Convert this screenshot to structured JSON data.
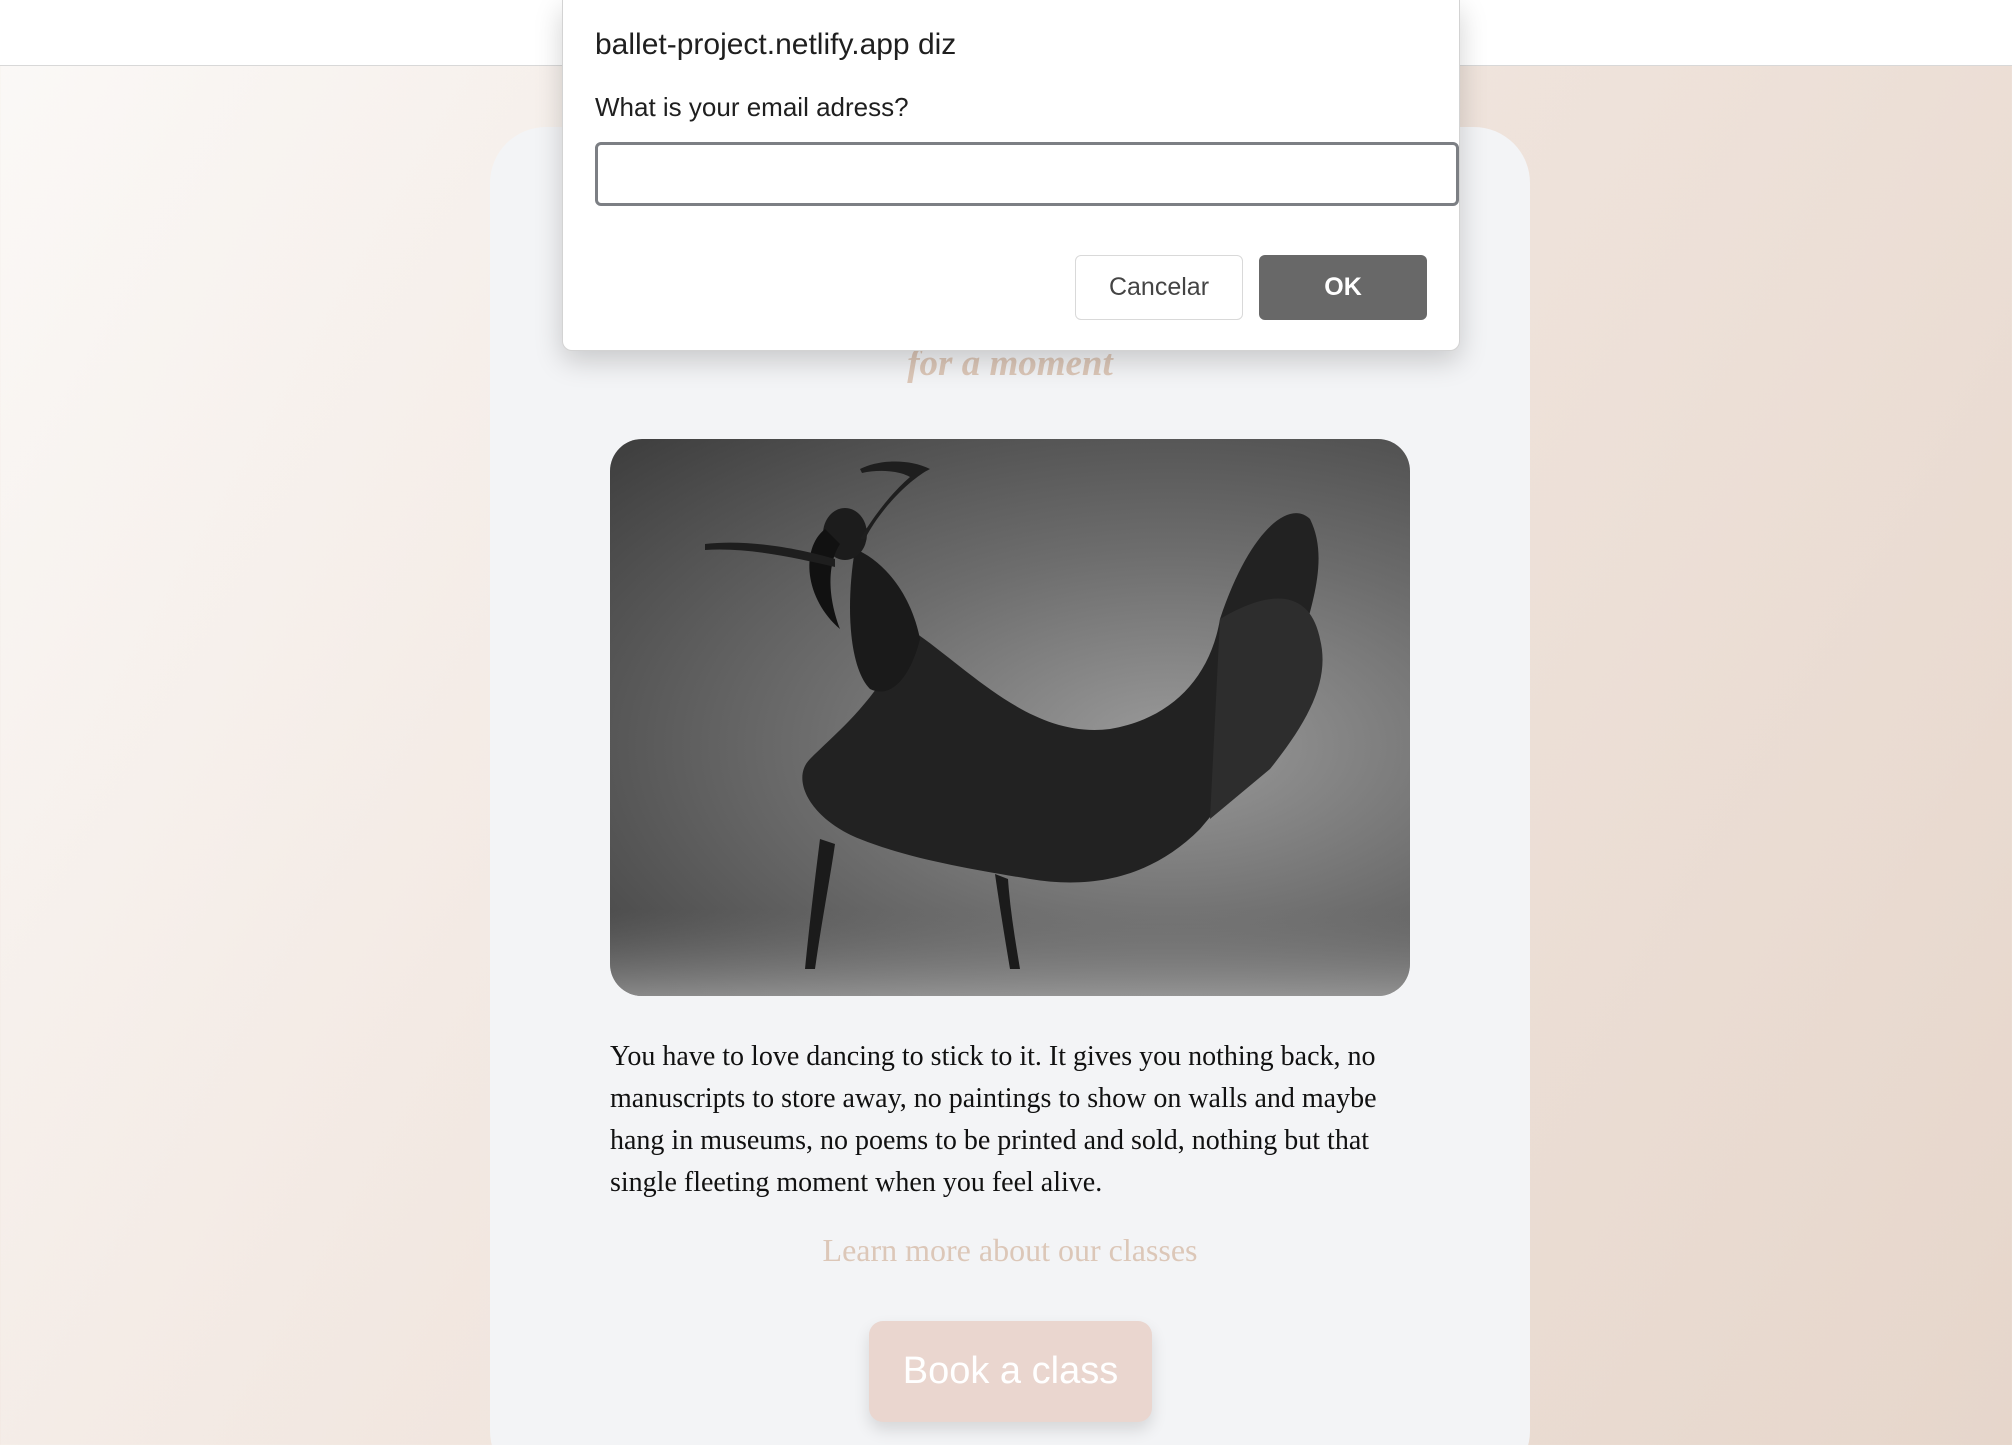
{
  "page": {
    "tagline": "for a moment",
    "photo_alt": "dancer-photo",
    "quote": "You have to love dancing to stick to it. It gives you nothing back, no manuscripts to store away, no paintings to show on walls and maybe hang in museums, no poems to be printed and sold, nothing but that single fleeting moment when you feel alive.",
    "learn_more_link": "Learn more about our classes",
    "book_button": "Book a class"
  },
  "dialog": {
    "title": "ballet-project.netlify.app diz",
    "message": "What is your email adress?",
    "input_value": "",
    "cancel_label": "Cancelar",
    "ok_label": "OK"
  },
  "colors": {
    "accent": "#dcc7b8",
    "button_bg": "#ead6cf",
    "ok_button_bg": "#686868",
    "card_bg": "#f3f4f6"
  }
}
